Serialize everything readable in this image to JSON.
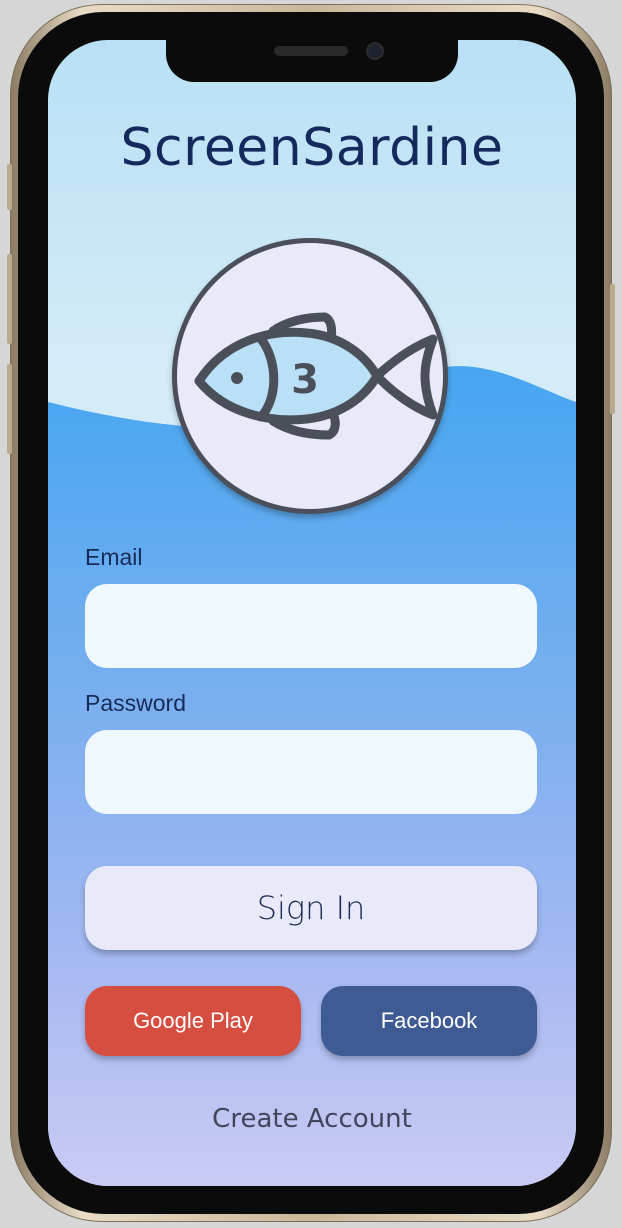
{
  "app": {
    "title": "ScreenSardine"
  },
  "logo": {
    "icon": "fish-icon",
    "fish_number": "3"
  },
  "form": {
    "email_label": "Email",
    "email_value": "",
    "password_label": "Password",
    "password_value": ""
  },
  "actions": {
    "sign_in": "Sign In",
    "google": "Google Play",
    "facebook": "Facebook",
    "create_account": "Create Account"
  },
  "colors": {
    "title": "#142a5c",
    "sky": "#b9e0f6",
    "water": "#47a6f0",
    "google": "#d54e3f",
    "facebook": "#3f5b93",
    "input": "#eff8fd",
    "sign_in": "#e8e9f9"
  }
}
